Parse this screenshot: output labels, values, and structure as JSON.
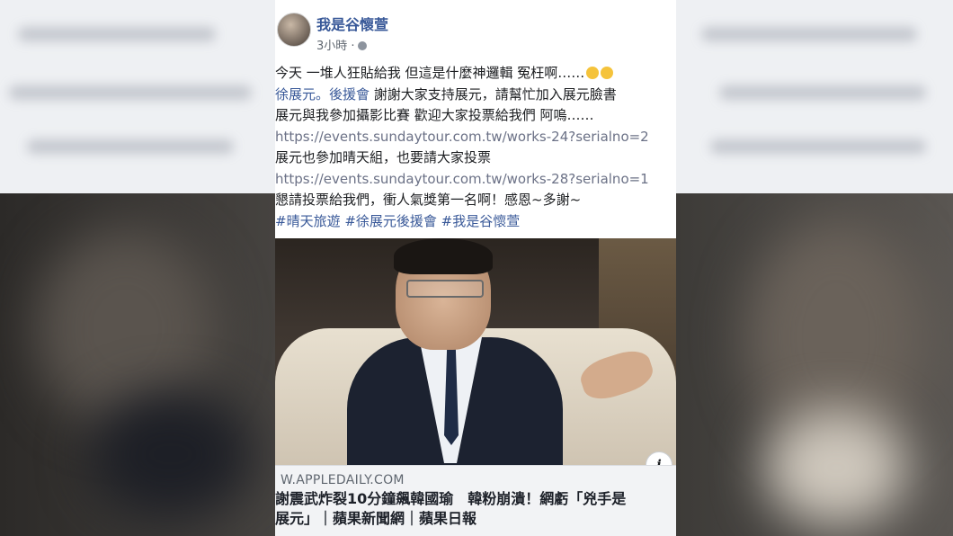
{
  "post": {
    "author": "我是谷懷萱",
    "time": "3小時 ·",
    "lines": [
      "今天 一堆人狂貼給我 但這是什麼神邏輯 冤枉啊……",
      "謝謝大家支持展元，請幫忙加入展元臉書",
      "展元與我參加攝影比賽 歡迎大家投票給我們 阿嗚……",
      "https://events.sundaytour.com.tw/works-24?serialno=2",
      "展元也參加晴天組，也要請大家投票",
      "https://events.sundaytour.com.tw/works-28?serialno=1",
      "懇請投票給我們，衝人氣獎第一名啊！感恩~多謝~"
    ],
    "line2_link": "徐展元。後援會",
    "hashtags": "#晴天旅遊 #徐展元後援會 #我是谷懷萱"
  },
  "preview": {
    "domain": "W.APPLEDAILY.COM",
    "headline_1": "謝震武炸裂10分鐘飆韓國瑜　韓粉崩潰！網虧「兇手是",
    "headline_2": "展元」｜蘋果新聞網｜蘋果日報",
    "info_icon_label": "i"
  },
  "icons": {
    "avatar": "avatar-photo",
    "globe": "globe-icon",
    "emoji": "smile-emoji-icon",
    "info": "info-icon"
  }
}
